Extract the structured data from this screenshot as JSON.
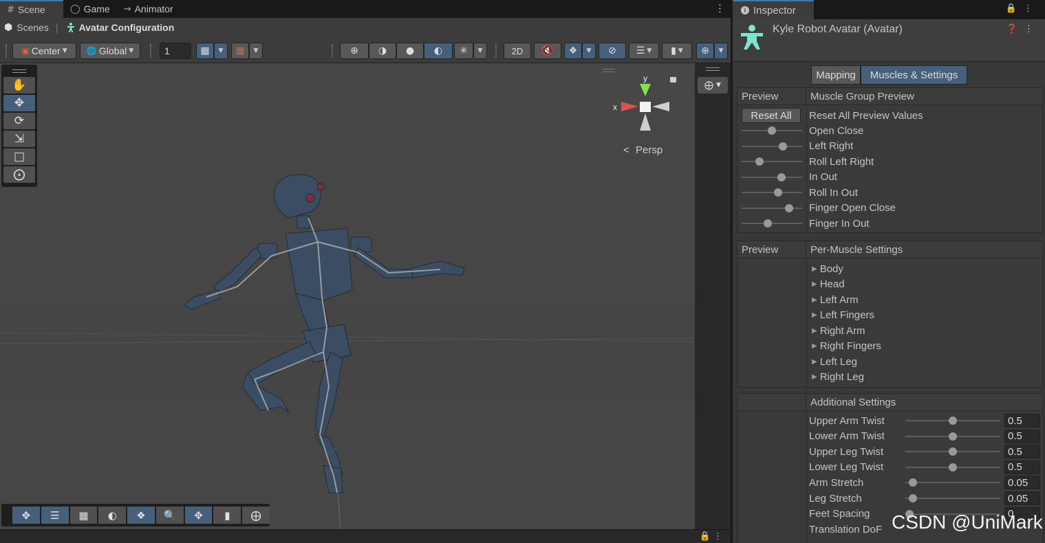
{
  "scene_window": {
    "tabs": [
      {
        "label": "Scene",
        "icon": "grid-icon"
      },
      {
        "label": "Game",
        "icon": "gamepad-icon"
      },
      {
        "label": "Animator",
        "icon": "animator-icon"
      }
    ],
    "breadcrumb": {
      "root": "Scenes",
      "current": "Avatar Configuration"
    },
    "toolbar": {
      "pivot_label": "Center",
      "space_label": "Global",
      "grid_size_value": "1",
      "two_d_label": "2D"
    },
    "gizmo": {
      "x_label": "x",
      "y_label": "y",
      "projection_label": "Persp"
    }
  },
  "inspector": {
    "tab_label": "Inspector",
    "title": "Kyle Robot Avatar (Avatar)",
    "modes": {
      "mapping": "Mapping",
      "muscles": "Muscles & Settings"
    },
    "muscle_group": {
      "header_left": "Preview",
      "header_right": "Muscle Group Preview",
      "reset_button": "Reset All",
      "reset_label": "Reset All Preview Values",
      "rows": [
        {
          "label": "Open Close",
          "value": 0.5
        },
        {
          "label": "Left Right",
          "value": 0.68
        },
        {
          "label": "Roll Left Right",
          "value": 0.3
        },
        {
          "label": "In Out",
          "value": 0.66
        },
        {
          "label": "Roll In Out",
          "value": 0.6
        },
        {
          "label": "Finger Open Close",
          "value": 0.78
        },
        {
          "label": "Finger In Out",
          "value": 0.43
        }
      ]
    },
    "per_muscle": {
      "header_left": "Preview",
      "header_right": "Per-Muscle Settings",
      "groups": [
        "Body",
        "Head",
        "Left Arm",
        "Left Fingers",
        "Right Arm",
        "Right Fingers",
        "Left Leg",
        "Right Leg"
      ]
    },
    "additional": {
      "header": "Additional Settings",
      "rows": [
        {
          "label": "Upper Arm Twist",
          "value": "0.5",
          "fraction": 0.5
        },
        {
          "label": "Lower Arm Twist",
          "value": "0.5",
          "fraction": 0.5
        },
        {
          "label": "Upper Leg Twist",
          "value": "0.5",
          "fraction": 0.5
        },
        {
          "label": "Lower Leg Twist",
          "value": "0.5",
          "fraction": 0.5
        },
        {
          "label": "Arm Stretch",
          "value": "0.05",
          "fraction": 0.08
        },
        {
          "label": "Leg Stretch",
          "value": "0.05",
          "fraction": 0.08
        },
        {
          "label": "Feet Spacing",
          "value": "0",
          "fraction": 0.04
        },
        {
          "label": "Translation DoF",
          "value": "",
          "fraction": 0
        }
      ]
    }
  },
  "watermark": "CSDN @UniMark",
  "colors": {
    "accent": "#46607c",
    "tab_highlight": "#3a79bb",
    "avatar_icon": "#7fe3d0",
    "gizmo_x": "#d9534f",
    "gizmo_y": "#8be04e"
  }
}
